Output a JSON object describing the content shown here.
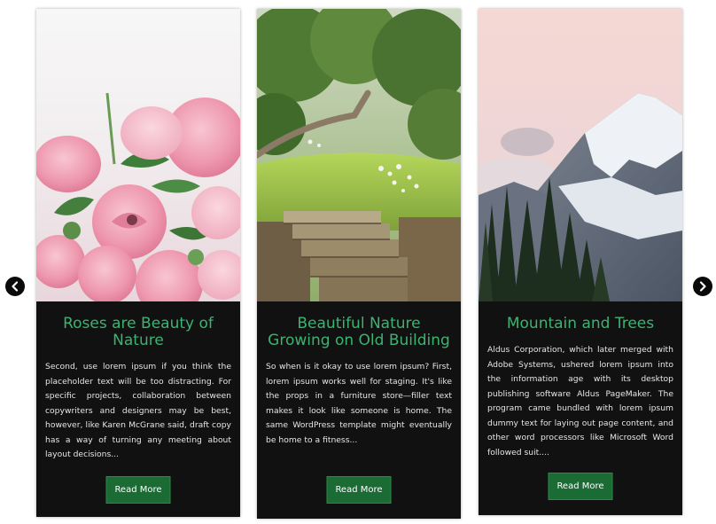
{
  "carousel": {
    "prev_icon": "chevron-left-icon",
    "next_icon": "chevron-right-icon",
    "cards": [
      {
        "image": "pink-roses-photo",
        "title": "Roses are Beauty of Nature",
        "text": "Second, use lorem ipsum if you think the placeholder text will be too distracting. For specific projects, collaboration between copywriters and designers may be best, however, like Karen McGrane said, draft copy has a way of turning any meeting about layout decisions...",
        "button": "Read More"
      },
      {
        "image": "garden-stone-steps-photo",
        "title": "Beautiful Nature Growing on Old Building",
        "text": "So when is it okay to use lorem ipsum? First, lorem ipsum works well for staging. It's like the props in a furniture store—filler text makes it look like someone is home. The same WordPress template might eventually be home to a fitness...",
        "button": "Read More"
      },
      {
        "image": "snowy-mountain-trees-photo",
        "title": "Mountain and Trees",
        "text": "Aldus Corporation, which later merged with Adobe Systems, ushered lorem ipsum into the information age with its desktop publishing software Aldus PageMaker. The program came bundled with lorem ipsum dummy text for laying out page content, and other word processors like Microsoft Word followed suit....",
        "button": "Read More"
      }
    ]
  },
  "colors": {
    "card_background": "#111111",
    "title": "#3cb371",
    "body_text": "#e6e6e6",
    "button_background": "#1a6b34",
    "nav_arrow": "#0a0a0a"
  }
}
